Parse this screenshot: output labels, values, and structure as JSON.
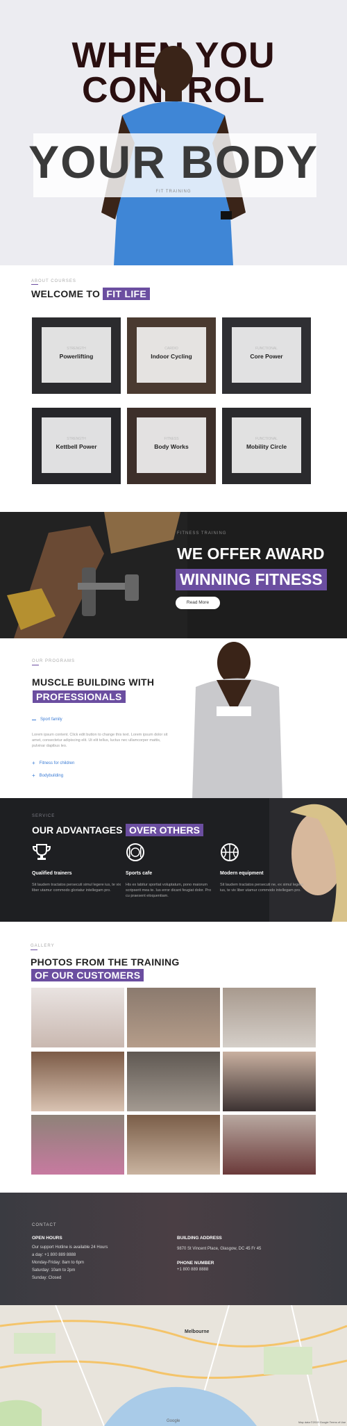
{
  "hero": {
    "title_line1": "WHEN YOU",
    "title_line2": "CONTROL",
    "title_big": "YOUR BODY",
    "subtitle": "FIT TRAINING"
  },
  "welcome": {
    "eyebrow": "ABOUT COURSES",
    "title": "WELCOME TO",
    "title_highlight": "FIT LIFE",
    "cards": [
      {
        "small": "STRENGTH",
        "name": "Powerlifting"
      },
      {
        "small": "CARDIO",
        "name": "Indoor Cycling"
      },
      {
        "small": "FUNCTIONAL",
        "name": "Core Power"
      },
      {
        "small": "STRENGTH",
        "name": "Kettbell Power"
      },
      {
        "small": "FITNESS",
        "name": "Body Works"
      },
      {
        "small": "FUNCTIONAL",
        "name": "Mobility Circle"
      }
    ]
  },
  "award": {
    "eyebrow": "FITNESS TRAINING",
    "title": "WE OFFER AWARD",
    "title_highlight": "WINNING FITNESS",
    "button": "Read More"
  },
  "muscle": {
    "eyebrow": "OUR PROGRAMS",
    "title": "MUSCLE BUILDING WITH",
    "title_highlight": "PROFESSIONALS",
    "link1": "Sport family",
    "paragraph": "Lorem ipsum content. Click edit button to change this text. Lorem ipsum dolor sit amet, consectetur adipiscing elit. Ut elit tellus, luctus nec ullamcorper mattis, pulvinar dapibus leo.",
    "link2": "Fitness for children",
    "link3": "Bodybuilding"
  },
  "advantages": {
    "eyebrow": "SERVICE",
    "title": "OUR ADVANTAGES",
    "title_highlight": "OVER OTHERS",
    "items": [
      {
        "icon": "trophy-icon",
        "title": "Qualified trainers",
        "text": "Sit laudem tractatos persecuti simul legere ius, te vix liber utamur commodo gloriatur intellegam pro."
      },
      {
        "icon": "dining-icon",
        "title": "Sports cafe",
        "text": "His ex labitur sportiat voluptatum, pono maiorum scripserit mea te. Ius error dicant feugiat dolor. Pro cu praesent eloquentiam."
      },
      {
        "icon": "ball-icon",
        "title": "Modern equipment",
        "text": "Sit laudem tractatos persecuti ne, ex simul legere ius, te vix liber utamur commodo intellegam pro."
      }
    ]
  },
  "photos": {
    "eyebrow": "GALLERY",
    "title": "PHOTOS FROM THE TRAINING",
    "title_highlight": "OF OUR CUSTOMERS"
  },
  "contact": {
    "eyebrow": "CONTACT",
    "open_title": "OPEN HOURS",
    "open_lines": [
      "Our support Hotline is available 24 Hours",
      "a day: +1 800 889 8888",
      "Monday-Friday: 8am to 6pm",
      "Saturday: 10am to 2pm",
      "Sunday: Closed"
    ],
    "addr_title": "BUILDING ADDRESS",
    "addr_line": "9870 St Vincent Place, Glasgow, DC 45 Fr 45",
    "phone_title": "PHONE NUMBER",
    "phone_line": "+1 800 889 8888"
  },
  "map": {
    "city": "Melbourne",
    "brand": "Google",
    "footer": "Map data ©2019 Google   Terms of Use"
  }
}
